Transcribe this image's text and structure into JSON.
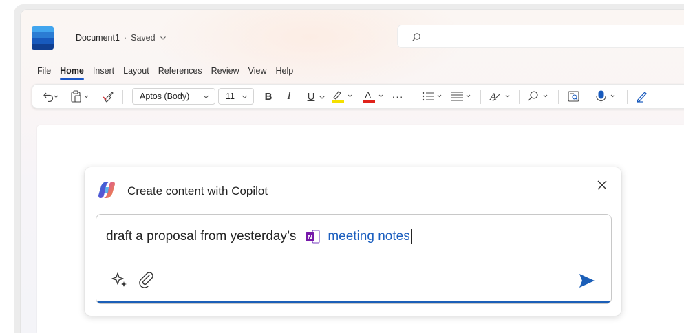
{
  "app": {
    "doc_name": "Document1",
    "title_separator": "·",
    "save_status": "Saved",
    "brand_color": "#185abd"
  },
  "menu": {
    "items": [
      "File",
      "Home",
      "Insert",
      "Layout",
      "References",
      "Review",
      "View",
      "Help"
    ],
    "active": "Home"
  },
  "toolbar": {
    "font_name": "Aptos (Body)",
    "font_size": "11",
    "bold_label": "B",
    "italic_label": "I",
    "underline_label": "U",
    "font_color_label": "A",
    "more_label": "···",
    "highlight_color": "#f5e000",
    "font_color": "#e0231b"
  },
  "copilot": {
    "title": "Create content with Copilot",
    "prompt_text": "draft a proposal from yesterday’s",
    "mention_label": "meeting notes",
    "onenote_letter": "N",
    "accent_color": "#1b5fb8"
  }
}
